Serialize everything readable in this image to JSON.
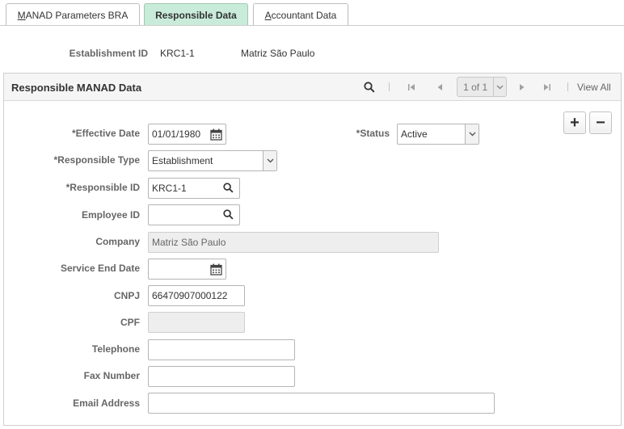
{
  "tabs": [
    {
      "prefix": "",
      "underline": "M",
      "rest": "ANAD Parameters BRA",
      "active": false
    },
    {
      "prefix": "",
      "underline": "",
      "rest": "Responsible Data",
      "active": true
    },
    {
      "prefix": "",
      "underline": "A",
      "rest": "ccountant Data",
      "active": false
    }
  ],
  "establishment": {
    "label": "Establishment ID",
    "value": "KRC1-1",
    "description": "Matriz São Paulo"
  },
  "panel": {
    "title": "Responsible MANAD Data",
    "pager_value": "1 of 1",
    "view_all": "View All"
  },
  "form": {
    "effective_date": {
      "label": "*Effective Date",
      "value": "01/01/1980"
    },
    "status": {
      "label": "*Status",
      "value": "Active"
    },
    "responsible_type": {
      "label": "*Responsible Type",
      "value": "Establishment"
    },
    "responsible_id": {
      "label": "*Responsible ID",
      "value": "KRC1-1"
    },
    "employee_id": {
      "label": "Employee ID",
      "value": ""
    },
    "company": {
      "label": "Company",
      "value": "Matriz São Paulo"
    },
    "service_end_date": {
      "label": "Service End Date",
      "value": ""
    },
    "cnpj": {
      "label": "CNPJ",
      "value": "66470907000122"
    },
    "cpf": {
      "label": "CPF",
      "value": ""
    },
    "telephone": {
      "label": "Telephone",
      "value": ""
    },
    "fax_number": {
      "label": "Fax Number",
      "value": ""
    },
    "email_address": {
      "label": "Email Address",
      "value": ""
    }
  },
  "buttons": {
    "add": "+",
    "delete": "−"
  },
  "colors": {
    "active_tab": "#c9ecda",
    "label_gray": "#666666",
    "disabled_field": "#eeeeee"
  }
}
